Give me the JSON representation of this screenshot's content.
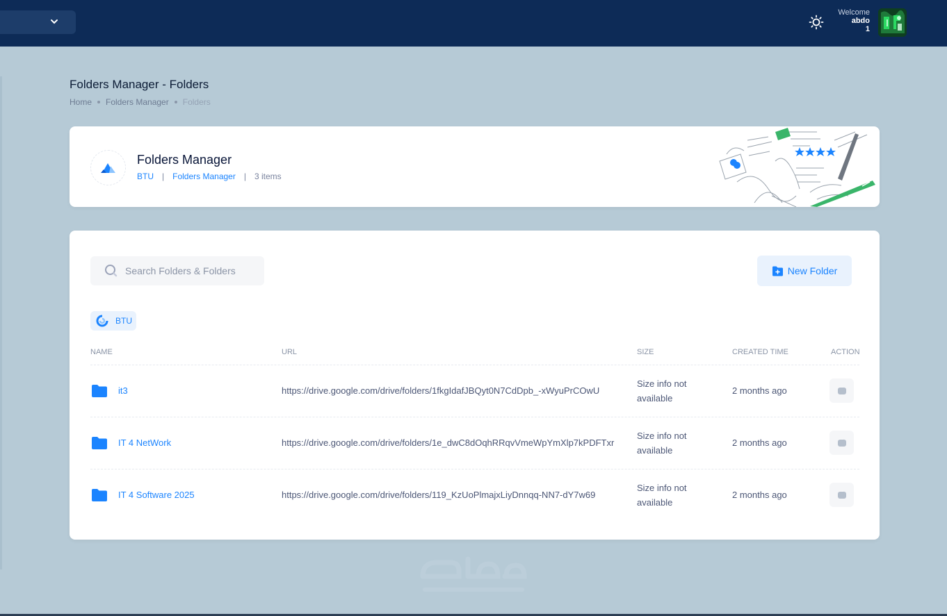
{
  "topbar": {
    "welcome_label": "Welcome",
    "user_name": "abdo",
    "user_suffix": "1"
  },
  "page": {
    "title": "Folders Manager - Folders",
    "breadcrumb": [
      "Home",
      "Folders Manager",
      "Folders"
    ]
  },
  "hero": {
    "title": "Folders Manager",
    "link1": "BTU",
    "link2": "Folders Manager",
    "count": "3 items"
  },
  "toolbar": {
    "search_placeholder": "Search Folders & Folders",
    "new_folder_label": "New Folder"
  },
  "filter_chip": "BTU",
  "table": {
    "headers": [
      "Name",
      "URL",
      "Size",
      "Created Time",
      "Action"
    ],
    "rows": [
      {
        "name": "it3",
        "url": "https://drive.google.com/drive/folders/1fkgIdafJBQyt0N7CdDpb_-xWyuPrCOwU",
        "size": "Size info not available",
        "created": "2 months ago"
      },
      {
        "name": "IT 4 NetWork",
        "url": "https://drive.google.com/drive/folders/1e_dwC8dOqhRRqvVmeWpYmXlp7kPDFTxr",
        "size": "Size info not available",
        "created": "2 months ago"
      },
      {
        "name": "IT 4 Software 2025",
        "url": "https://drive.google.com/drive/folders/119_KzUoPlmajxLiyDnnqq-NN7-dY7w69",
        "size": "Size info not available",
        "created": "2 months ago"
      }
    ]
  },
  "colors": {
    "topbar": "#0d2b57",
    "background": "#b6cad6",
    "accent": "#1b84ff"
  },
  "icons": [
    "chevron-down-icon",
    "sun-icon",
    "search-icon",
    "folder-plus-icon",
    "folder-icon",
    "more-icon"
  ]
}
